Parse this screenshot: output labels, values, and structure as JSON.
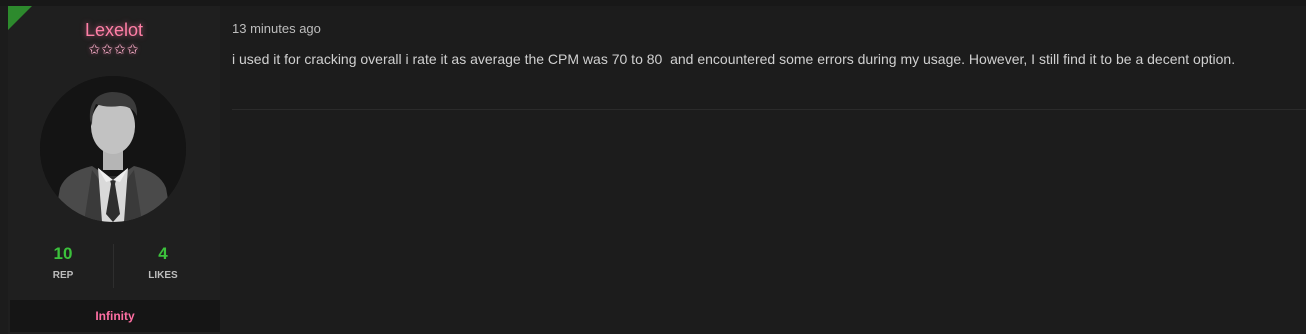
{
  "author": {
    "username": "Lexelot",
    "rank_stars": "✩✩✩✩",
    "avatar_icon": "default-user-avatar",
    "rep_value": "10",
    "rep_label": "REP",
    "likes_value": "4",
    "likes_label": "LIKES",
    "usergroup": "Infinity"
  },
  "post": {
    "time": "13 minutes ago",
    "body": "i used it for cracking overall i rate it as average the CPM was 70 to 80  and encountered some errors during my usage. However, I still find it to be a decent option."
  },
  "colors": {
    "username": "#ff7fa6",
    "stat_value": "#3cc13c",
    "usergroup": "#ff6fa3",
    "flag": "#2d8a2d"
  }
}
